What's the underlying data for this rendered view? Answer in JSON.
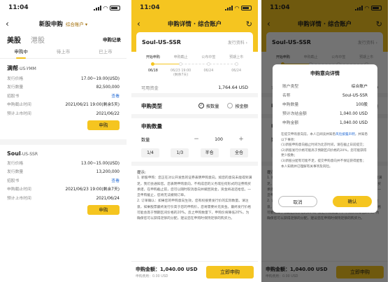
{
  "status_bar": {
    "time": "11:04",
    "time_arrow": "↗"
  },
  "screen1": {
    "title": "新股申购",
    "account_label": "综合账户",
    "market_tabs": [
      "美股",
      "港股"
    ],
    "records_label": "申购记录",
    "status_tabs": [
      "申购中",
      "待上市",
      "已上市"
    ],
    "cards": [
      {
        "name": "满帮",
        "code": "-US-YMM",
        "rows": [
          {
            "label": "发行价格",
            "value": "17.00~19.00(USD)"
          },
          {
            "label": "发行数量",
            "value": "82,500,000"
          },
          {
            "label": "招股书",
            "value": "查看"
          },
          {
            "label": "申购截止时间",
            "value": "2021/06/21 19:00(剩余5天)"
          },
          {
            "label": "预计上市时间",
            "value": "2021/06/22"
          }
        ],
        "button": "申购"
      },
      {
        "name": "Soul",
        "code": "-US-SSR",
        "rows": [
          {
            "label": "发行价格",
            "value": "13.00~15.00(USD)"
          },
          {
            "label": "发行数量",
            "value": "13,200,000"
          },
          {
            "label": "招股书",
            "value": "查看"
          },
          {
            "label": "申购截止时间",
            "value": "2021/06/23 19:00(剩余7天)"
          },
          {
            "label": "预计上市时间",
            "value": "2021/06/24"
          }
        ],
        "button": "申购"
      }
    ]
  },
  "screen2": {
    "title": "申购详情 · 综合账户",
    "stock": "Soul-US-SSR",
    "detail_link": "发行资料 ›",
    "timeline": {
      "steps": [
        "开始申购",
        "申购截止",
        "公布中签",
        "预期上市"
      ],
      "dates": [
        "06/18",
        "06/23 19:00\n(剩余7天)",
        "06/24",
        "06/24"
      ]
    },
    "balance_label": "可用资金",
    "balance_value": "1,764.64 USD",
    "type_label": "申购类型",
    "type_options": [
      "按数量",
      "按金额"
    ],
    "qty_title": "申购数量",
    "qty_label": "数量",
    "qty_value": "100",
    "minus": "−",
    "plus": "+",
    "chips": [
      "1/4",
      "1/3",
      "半仓",
      "全仓"
    ],
    "tips_title": "提示:",
    "tips": [
      "1. 新股申购：您正在对公开发售的证券表明申购意向，如您的意向未能得到满足，我们会通知您。您表明申购意向，不构成您的义务或任何形式的证券购买承诺，在申购截止前，您可以随时取消意向并撤回资金，资金将返还给您。一旦申购截止，您将无法撤销订单。",
      "2. 订单确认：如果您的申购意向生效，您有权接受发行价的实际数量。请注意，如果股票最终发行价高于您的申购价，您将需要补充资金。最终发行价格可能会高于预期区间价格的20%。反之申购数量下，申购价将降低20%，为确保您可以获得足够的分配，建议您在申购时保持足够的购买力。"
    ],
    "amount_label": "申购金额：",
    "amount_value": "1,040.00 USD",
    "fee_label": "申购费用：",
    "fee_value": "0.00 USD",
    "submit": "立即申购"
  },
  "screen3": {
    "dialog_title": "申购意向详情",
    "rows": [
      {
        "label": "账户类型",
        "value": "综合账户"
      },
      {
        "label": "名称",
        "value": "Soul-US-SSR"
      },
      {
        "label": "申购数量",
        "value": "100股"
      },
      {
        "label": "预计冻结金额",
        "value": "1,040.00 USD"
      },
      {
        "label": "申购金额",
        "value": "1,040.00 USD"
      }
    ],
    "note_prefix": "在提交申购意向前，本人已阅读并知悉",
    "note_link": "风险披露声明",
    "note_suffix": "，并知悉以下事项：",
    "notes": [
      "(1)新股申购意向截止时间为北京时间，请在截止日前提交；",
      "(2)新股发行价格可能高于预期区间价格的20%，您可能获得更少股数；",
      "(3)新股分配有可能不足，提交申购意向并不保证获得配售；",
      "本人知晓并已理解有关事项及风险。"
    ],
    "cancel": "取消",
    "confirm": "确认"
  }
}
